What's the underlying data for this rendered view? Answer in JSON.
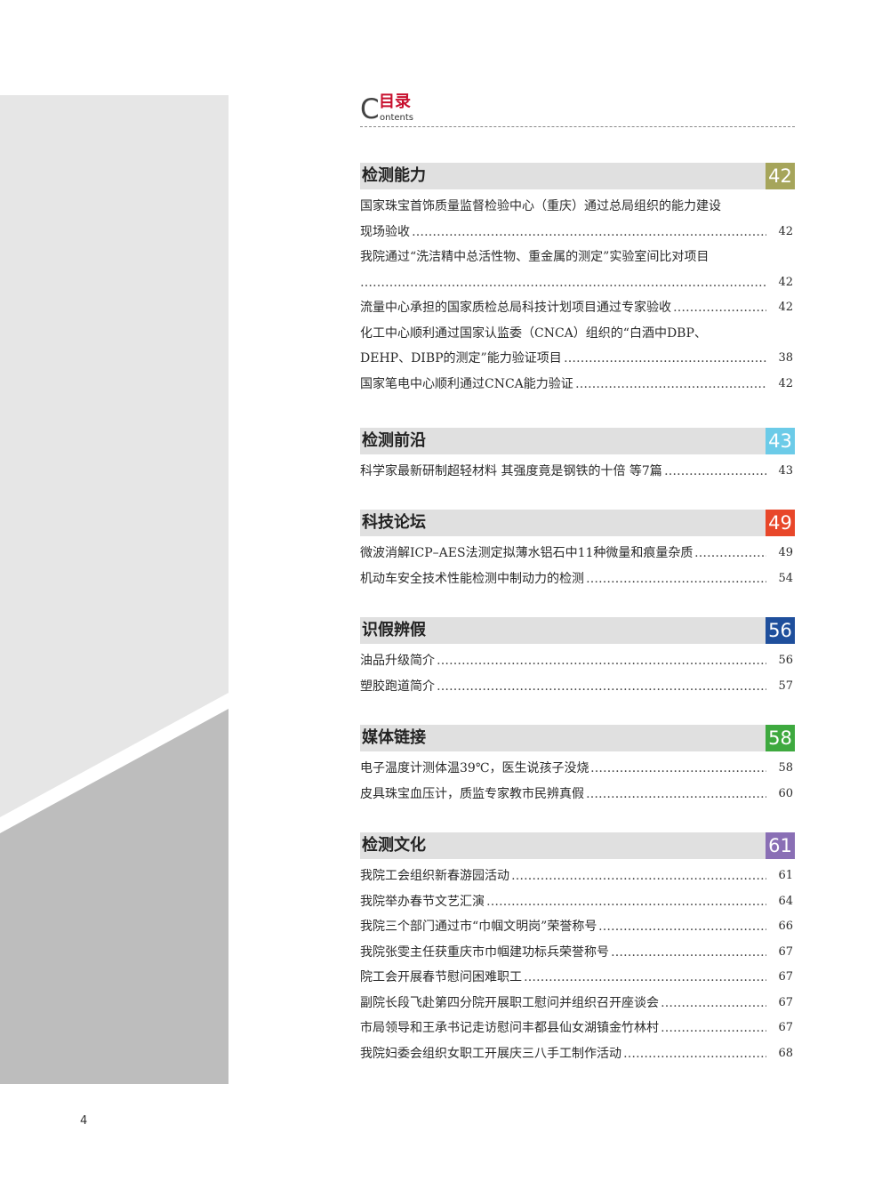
{
  "header": {
    "c_letter": "C",
    "title_cn": "目录",
    "title_en": "ontents"
  },
  "page_number": "4",
  "sections": [
    {
      "title": "检测能力",
      "number": "42",
      "color": "#a6a55b",
      "items": [
        {
          "text": "国家珠宝首饰质量监督检验中心（重庆）通过总局组织的能力建设",
          "page": ""
        },
        {
          "text": "现场验收",
          "page": "42"
        },
        {
          "text": "我院通过“洗洁精中总活性物、重金属的测定”实验室间比对项目",
          "page": ""
        },
        {
          "text": "",
          "page": "42"
        },
        {
          "text": "流量中心承担的国家质检总局科技计划项目通过专家验收",
          "page": "42"
        },
        {
          "text": "化工中心顺利通过国家认监委（CNCA）组织的“白酒中DBP、",
          "page": ""
        },
        {
          "text": "DEHP、DIBP的测定”能力验证项目",
          "page": "38"
        },
        {
          "text": "国家笔电中心顺利通过CNCA能力验证",
          "page": "42"
        }
      ]
    },
    {
      "title": "检测前沿",
      "number": "43",
      "color": "#6ccbe8",
      "items": [
        {
          "text": "科学家最新研制超轻材料 其强度竟是钢铁的十倍 等7篇",
          "page": "43"
        }
      ]
    },
    {
      "title": "科技论坛",
      "number": "49",
      "color": "#e8472a",
      "items": [
        {
          "text": "微波消解ICP–AES法测定拟薄水铝石中11种微量和痕量杂质",
          "page": "49"
        },
        {
          "text": "机动车安全技术性能检测中制动力的检测",
          "page": "54"
        }
      ]
    },
    {
      "title": "识假辨假",
      "number": "56",
      "color": "#1f4f9c",
      "items": [
        {
          "text": "油品升级简介",
          "page": "56"
        },
        {
          "text": "塑胶跑道简介",
          "page": "57"
        }
      ]
    },
    {
      "title": "媒体链接",
      "number": "58",
      "color": "#3ea93f",
      "items": [
        {
          "text": "电子温度计测体温39℃，医生说孩子没烧",
          "page": "58"
        },
        {
          "text": "皮具珠宝血压计，质监专家教市民辨真假",
          "page": "60"
        }
      ]
    },
    {
      "title": "检测文化",
      "number": "61",
      "color": "#8a6fb5",
      "items": [
        {
          "text": "我院工会组织新春游园活动",
          "page": "61"
        },
        {
          "text": "我院举办春节文艺汇演",
          "page": "64"
        },
        {
          "text": "我院三个部门通过市“巾帼文明岗”荣誉称号",
          "page": "66"
        },
        {
          "text": "我院张雯主任获重庆市巾帼建功标兵荣誉称号",
          "page": "67"
        },
        {
          "text": "院工会开展春节慰问困难职工",
          "page": "67"
        },
        {
          "text": "副院长段飞赴第四分院开展职工慰问并组织召开座谈会",
          "page": "67"
        },
        {
          "text": "市局领导和王承书记走访慰问丰都县仙女湖镇金竹林村",
          "page": "67"
        },
        {
          "text": "我院妇委会组织女职工开展庆三八手工制作活动",
          "page": "68"
        }
      ]
    }
  ]
}
